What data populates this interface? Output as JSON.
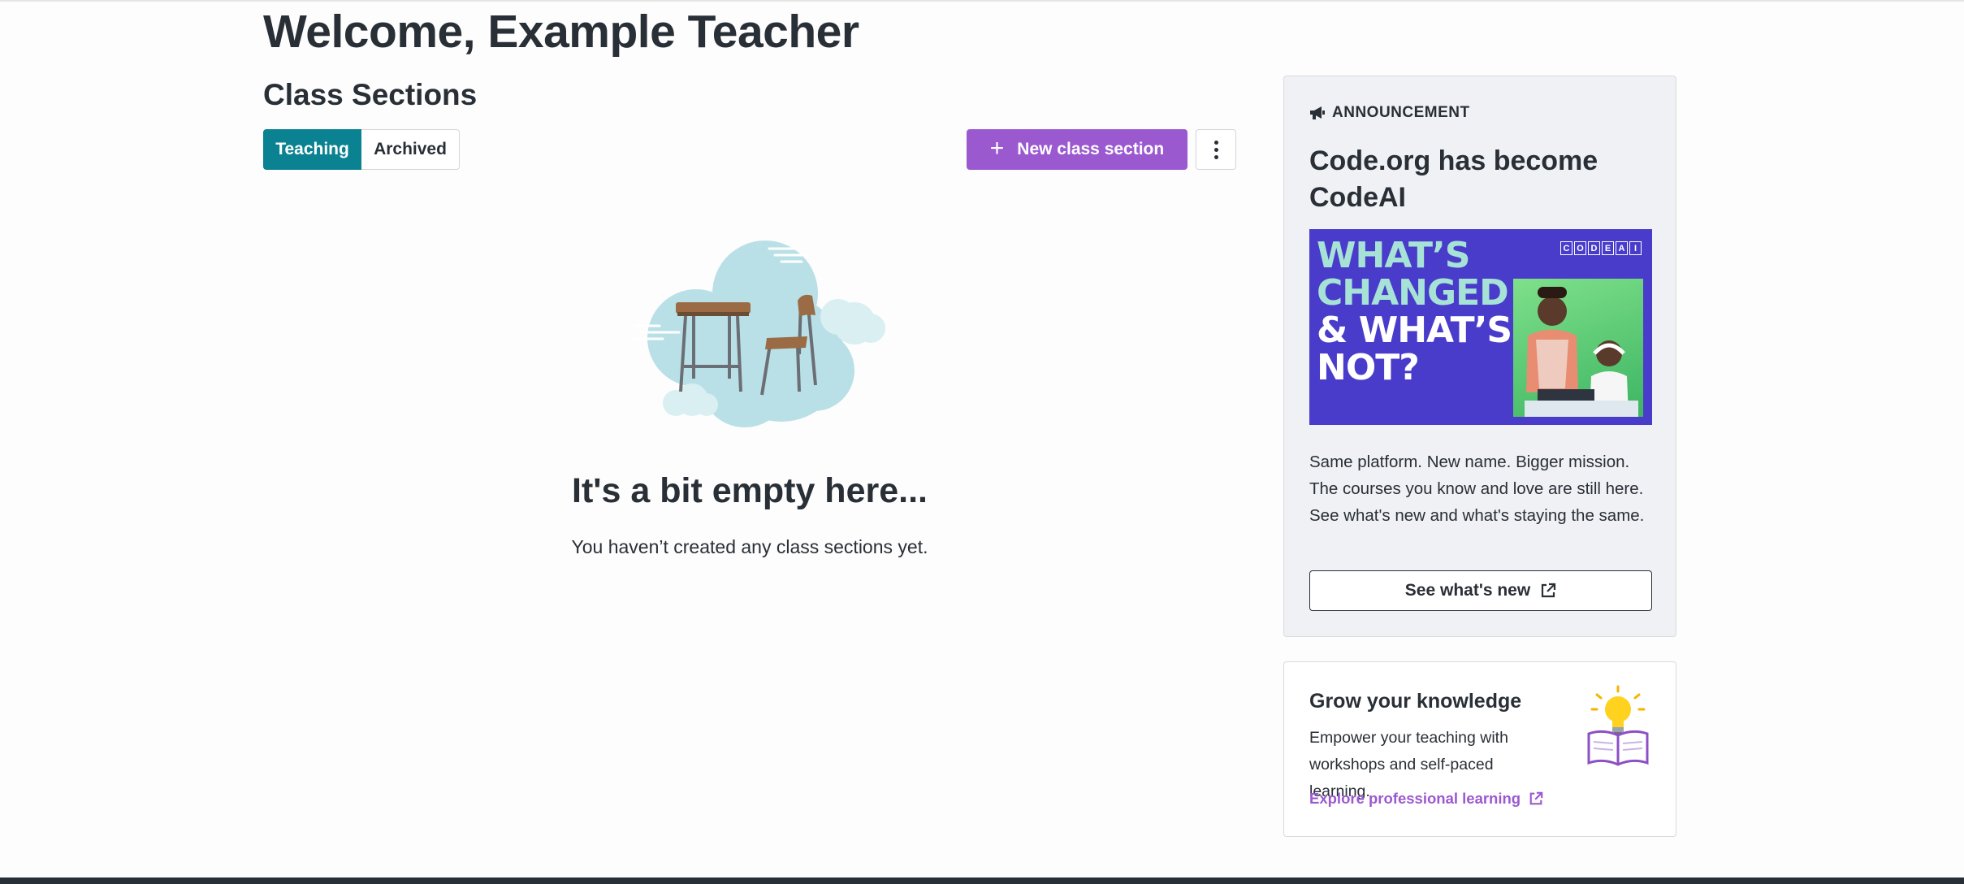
{
  "welcome": {
    "title": "Welcome, Example Teacher"
  },
  "sections": {
    "title": "Class Sections",
    "tabs": [
      {
        "label": "Teaching",
        "active": true
      },
      {
        "label": "Archived",
        "active": false
      }
    ],
    "new_button": "New class section",
    "more_icon": "kebab-menu-icon",
    "empty": {
      "title": "It's a bit empty here...",
      "subtitle": "You haven’t created any class sections yet."
    }
  },
  "announcement": {
    "label": "ANNOUNCEMENT",
    "icon": "megaphone-icon",
    "title": "Code.org has become CodeAI",
    "image": {
      "lines": [
        "WHAT’S",
        "CHANGED",
        "& WHAT’S",
        "NOT?"
      ],
      "brand": [
        "C",
        "O",
        "D",
        "E",
        "A",
        "I"
      ]
    },
    "body": "Same platform. New name. Bigger mission. The courses you know and love are still here. See what's new and what's staying the same.",
    "link": "See what's new",
    "link_icon": "external-link-icon"
  },
  "grow": {
    "title": "Grow your knowledge",
    "body": "Empower your teaching with workshops and self-paced learning.",
    "link": "Explore professional learning",
    "icon": "lightbulb-book-icon"
  },
  "colors": {
    "teal": "#0a8291",
    "purple": "#9b59d0",
    "text": "#292f36",
    "announcement_bg": "#f0f1f5",
    "banner_bg": "#4a3ccb"
  }
}
